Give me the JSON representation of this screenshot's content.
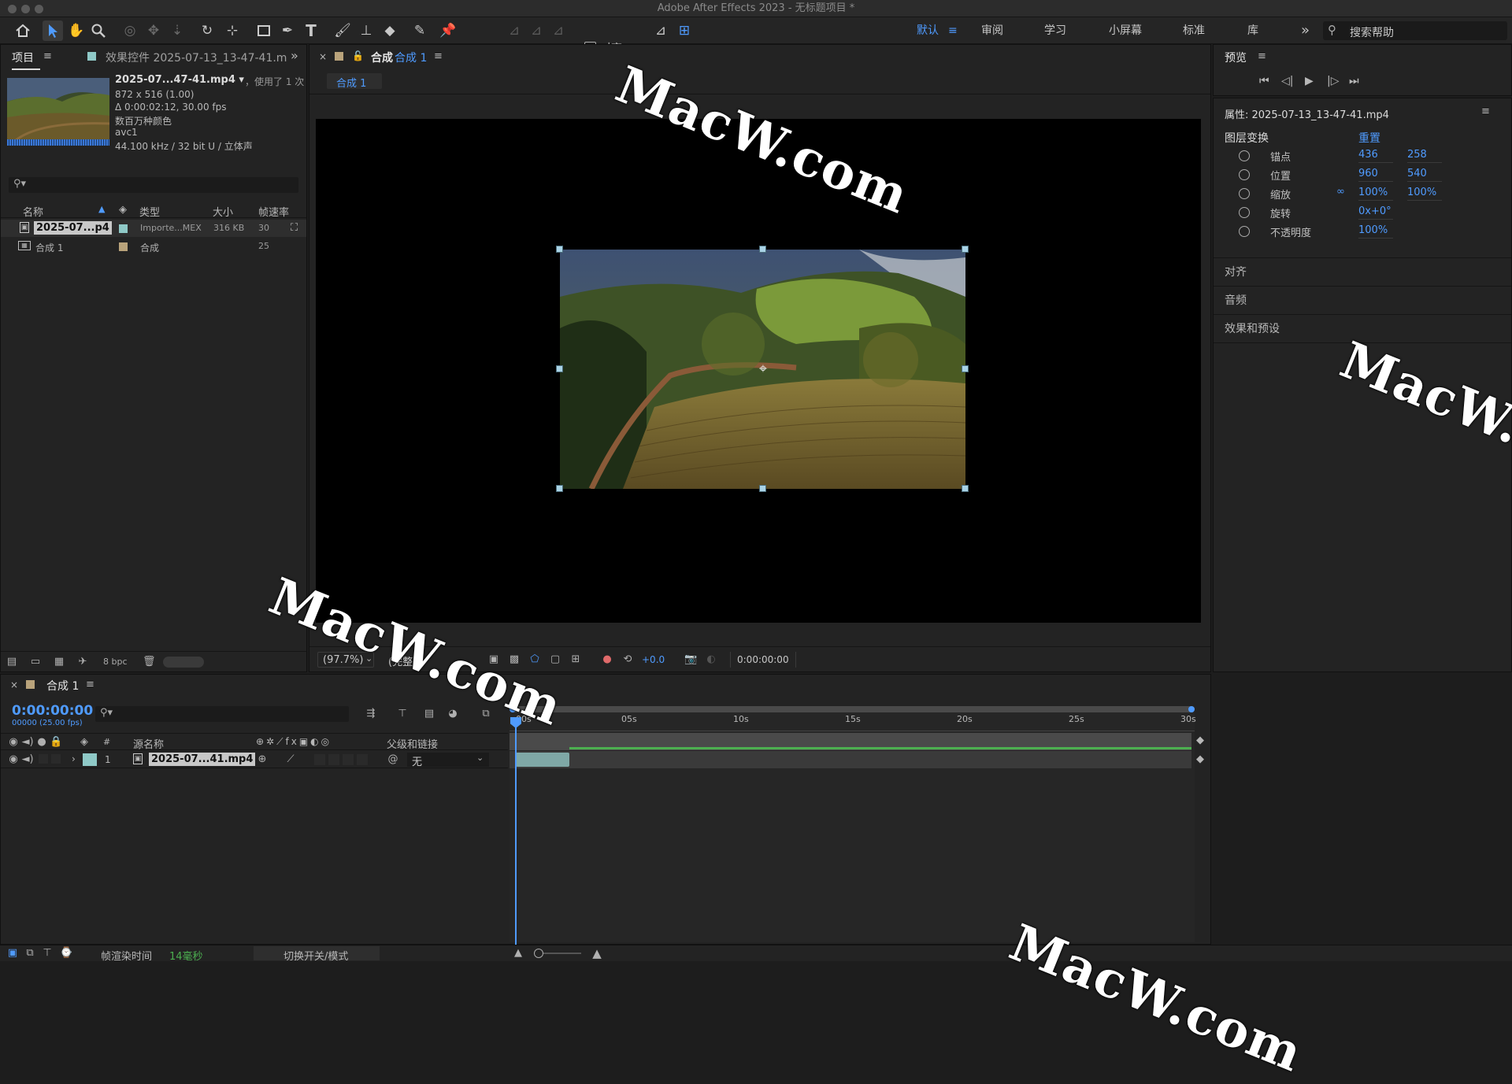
{
  "window": {
    "title": "Adobe After Effects 2023 - 无标题项目 *"
  },
  "toolbar": {
    "align_label": "对齐"
  },
  "workspaces": {
    "items": [
      "默认",
      "审阅",
      "学习",
      "小屏幕",
      "标准",
      "库"
    ],
    "more": "»",
    "search_placeholder": "搜索帮助"
  },
  "project_panel": {
    "tab_project": "项目",
    "tab_effects": "效果控件 2025-07-13_13-47-41.m",
    "footage": {
      "name": "2025-07...47-41.mp4 ▾",
      "used": "，使用了 1 次",
      "dims": "872 x 516 (1.00)",
      "duration": "Δ 0:00:02:12, 30.00 fps",
      "colors": "数百万种颜色",
      "codec": "avc1",
      "audio": "44.100 kHz / 32 bit U / 立体声"
    },
    "search_placeholder": "",
    "columns": {
      "name": "名称",
      "type": "类型",
      "size": "大小",
      "fps": "帧速率"
    },
    "rows": [
      {
        "name": "2025-07...p4",
        "type": "Importe...MEX",
        "size": "316 KB",
        "fps": "30",
        "label_color": "#8fc9c7"
      },
      {
        "name": "合成 1",
        "type": "合成",
        "size": "",
        "fps": "25",
        "label_color": "#b9a37b"
      }
    ],
    "bpc": "8 bpc"
  },
  "comp_viewer": {
    "tab_label": "合成",
    "tab_comp": "合成 1",
    "sub_tab": "合成 1",
    "zoom": "(97.7%)",
    "quality": "(完整)",
    "exposure": "+0.0",
    "timecode": "0:00:00:00"
  },
  "preview_panel": {
    "title": "预览"
  },
  "properties_panel": {
    "title": "属性: 2025-07-13_13-47-41.mp4",
    "section": "图层变换",
    "reset": "重置",
    "props": [
      {
        "label": "锚点",
        "v1": "436",
        "v2": "258"
      },
      {
        "label": "位置",
        "v1": "960",
        "v2": "540"
      },
      {
        "label": "缩放",
        "v1": "100%",
        "v2": "100%"
      },
      {
        "label": "旋转",
        "v1": "0x+0°",
        "v2": ""
      },
      {
        "label": "不透明度",
        "v1": "100%",
        "v2": ""
      }
    ],
    "sections": [
      "对齐",
      "音频",
      "效果和预设"
    ]
  },
  "timeline": {
    "tab": "合成 1",
    "timecode": "0:00:00:00",
    "frames": "00000 (25.00 fps)",
    "col_source": "源名称",
    "col_parent": "父级和链接",
    "col_num": "#",
    "layer": {
      "num": "1",
      "name": "2025-07...41.mp4",
      "parent": "无"
    },
    "ruler": [
      "00s",
      "05s",
      "10s",
      "15s",
      "20s",
      "25s",
      "30s"
    ],
    "footer": {
      "render_label": "帧渲染时间",
      "render_value": "14毫秒",
      "toggle": "切换开关/模式"
    }
  },
  "watermark": "MacW.com"
}
